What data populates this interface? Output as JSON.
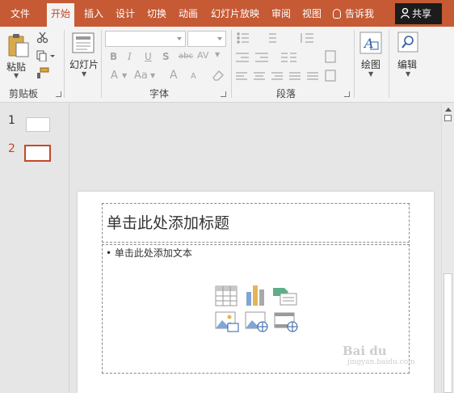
{
  "tabs": [
    {
      "label": "文件",
      "active": false
    },
    {
      "label": "开始",
      "active": true
    },
    {
      "label": "插入",
      "active": false
    },
    {
      "label": "设计",
      "active": false
    },
    {
      "label": "切换",
      "active": false
    },
    {
      "label": "动画",
      "active": false
    },
    {
      "label": "幻灯片放映",
      "active": false
    },
    {
      "label": "审阅",
      "active": false
    },
    {
      "label": "视图",
      "active": false
    }
  ],
  "tell_me": "告诉我",
  "share": "共享",
  "ribbon": {
    "clipboard": {
      "paste": "粘贴",
      "group": "剪贴板"
    },
    "slides": {
      "new_slide": "幻灯片"
    },
    "font": {
      "group": "字体",
      "bold": "B",
      "italic": "I",
      "underline": "U",
      "shadow": "S",
      "strike": "abc",
      "spacing": "AV",
      "font_color": "A",
      "change_case": "Aa",
      "grow": "A",
      "shrink": "A"
    },
    "paragraph": {
      "group": "段落"
    },
    "drawing": {
      "label": "绘图"
    },
    "editing": {
      "label": "编辑"
    }
  },
  "thumbnails": [
    {
      "number": "1",
      "selected": false
    },
    {
      "number": "2",
      "selected": true
    }
  ],
  "slide": {
    "title_placeholder": "单击此处添加标题",
    "body_placeholder": "• 单击此处添加文本"
  },
  "watermark": {
    "main": "Bai du",
    "sub": "jingyan.baidu.com"
  },
  "colors": {
    "accent": "#c55a35",
    "share_bg": "#1c1c1c",
    "selected_thumb": "#c4482b"
  }
}
